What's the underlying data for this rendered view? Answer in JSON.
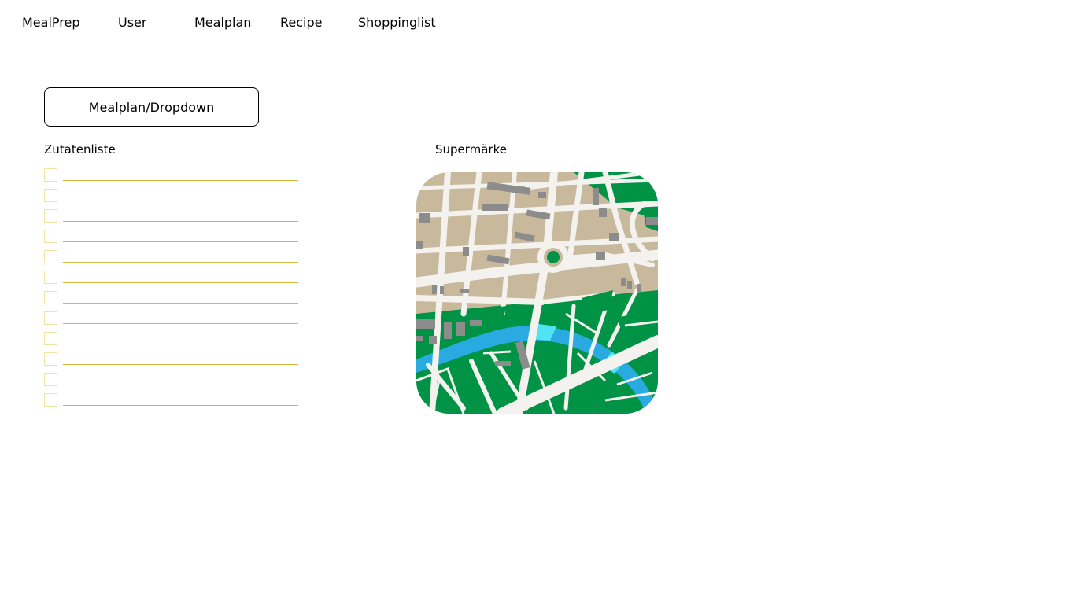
{
  "nav": {
    "brand": "MealPrep",
    "items": [
      "User",
      "Mealplan",
      "Recipe",
      "Shoppinglist"
    ],
    "active": "Shoppinglist"
  },
  "dropdown": {
    "label": "Mealplan/Dropdown"
  },
  "ingredients": {
    "title": "Zutatenliste",
    "items": [
      "",
      "",
      "",
      "",
      "",
      "",
      "",
      "",
      "",
      "",
      "",
      ""
    ],
    "checked": [
      false,
      false,
      false,
      false,
      false,
      false,
      false,
      false,
      false,
      false,
      false,
      false
    ]
  },
  "supermarkets": {
    "title": "Supermärke",
    "map_icon": "city-map-icon"
  },
  "colors": {
    "checkbox_border": "#f0e3a6",
    "line": "#d8b73c",
    "map_land": "#c8b99c",
    "map_road": "#f4f2ee",
    "map_green": "#009245",
    "map_water": "#29abe2",
    "map_water_light": "#4fe4f4",
    "map_building": "#8c8c8c"
  }
}
